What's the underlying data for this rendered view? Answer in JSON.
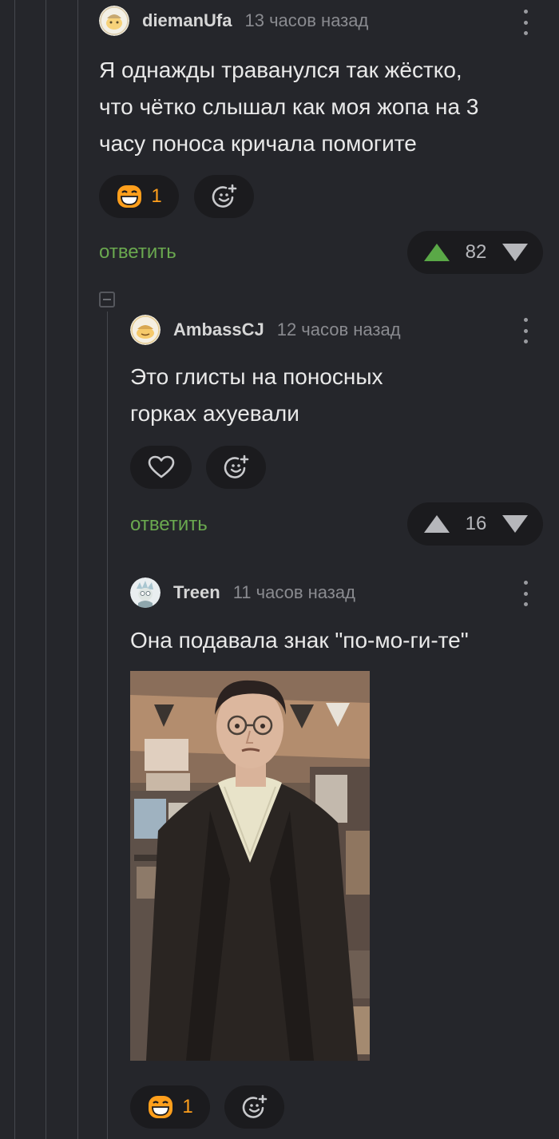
{
  "comments": [
    {
      "username": "diemanUfa",
      "time": "13 часов назад",
      "text_lines": [
        "Я однажды траванулся так жёстко,",
        "что чётко слышал как моя жопа на 3",
        "часу поноса кричала помогите"
      ],
      "reaction": "1",
      "reply": "ответить",
      "rating": "82"
    },
    {
      "username": "AmbassCJ",
      "time": "12 часов назад",
      "text_lines": [
        "Это глисты на поносных",
        "горках ахуевали"
      ],
      "reply": "ответить",
      "rating": "16"
    },
    {
      "username": "Treen",
      "time": "11 часов назад",
      "text_lines": [
        "Она подавала знак \"по-мо-ги-те\""
      ],
      "reaction": "1"
    }
  ],
  "colors": {
    "background": "#25262b",
    "reply_green": "#6aa84f",
    "upvote_active": "#5aa847",
    "reaction_orange": "#ff9f1c"
  }
}
